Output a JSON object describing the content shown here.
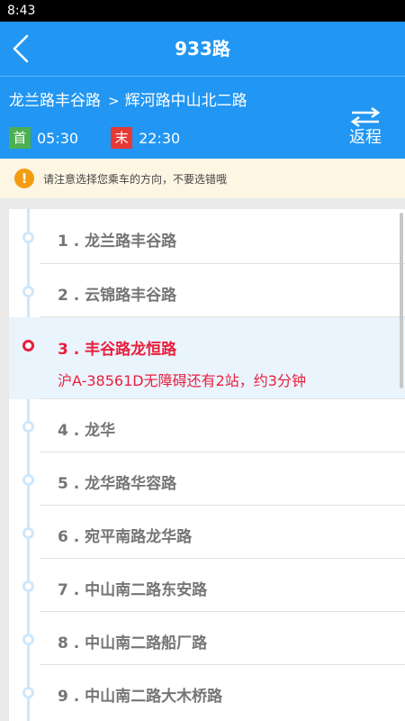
{
  "status_bar": {
    "time": "8:43"
  },
  "header": {
    "title": "933路",
    "back_icon": "chevron-left-icon"
  },
  "route": {
    "from": "龙兰路丰谷路",
    "arrow": ">",
    "to": "辉河路中山北二路",
    "first_label": "首",
    "first_time": "05:30",
    "last_label": "末",
    "last_time": "22:30",
    "return_label": "返程",
    "return_icon": "swap-arrows-icon"
  },
  "notice": {
    "icon": "exclamation-icon",
    "text": "请注意选择您乘车的方向，不要选错哦"
  },
  "stops": [
    {
      "label": "1 . 龙兰路丰谷路"
    },
    {
      "label": "2 . 云锦路丰谷路"
    },
    {
      "label": "3 . 丰谷路龙恒路",
      "bus_info": "沪A-38561D无障碍还有2站，约3分钟"
    },
    {
      "label": "4 . 龙华"
    },
    {
      "label": "5 . 龙华路华容路"
    },
    {
      "label": "6 . 宛平南路龙华路"
    },
    {
      "label": "7 . 中山南二路东安路"
    },
    {
      "label": "8 . 中山南二路船厂路"
    },
    {
      "label": "9 . 中山南二路大木桥路"
    }
  ],
  "colors": {
    "primary": "#2196f3",
    "first_badge": "#4caf50",
    "last_badge": "#e53935",
    "active_stop": "#e91e3c",
    "notice_bg": "#fdf6e3",
    "notice_icon": "#f39c12"
  }
}
